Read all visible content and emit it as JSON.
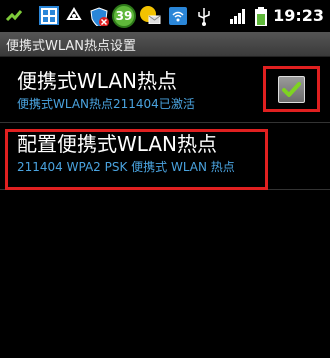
{
  "status_bar": {
    "icons": [
      "usb-debug-icon",
      "app-icon",
      "recycle-icon",
      "shield-icon",
      "notification-count-icon",
      "message-icon",
      "wifi-hotspot-icon",
      "usb-icon",
      "signal-icon",
      "battery-icon"
    ],
    "notification_count": "39",
    "time": "19:23",
    "accent_color": "#2a9ad8"
  },
  "title_bar": {
    "title": "便携式WLAN热点设置"
  },
  "settings": {
    "hotspot_toggle": {
      "title": "便携式WLAN热点",
      "summary": "便携式WLAN热点211404已激活",
      "checked": true
    },
    "configure_hotspot": {
      "title": "配置便携式WLAN热点",
      "summary": "211404 WPA2 PSK 便携式 WLAN 热点"
    }
  },
  "colors": {
    "highlight": "#e02020",
    "summary_text": "#4aa3df",
    "check": "#7ed321"
  }
}
